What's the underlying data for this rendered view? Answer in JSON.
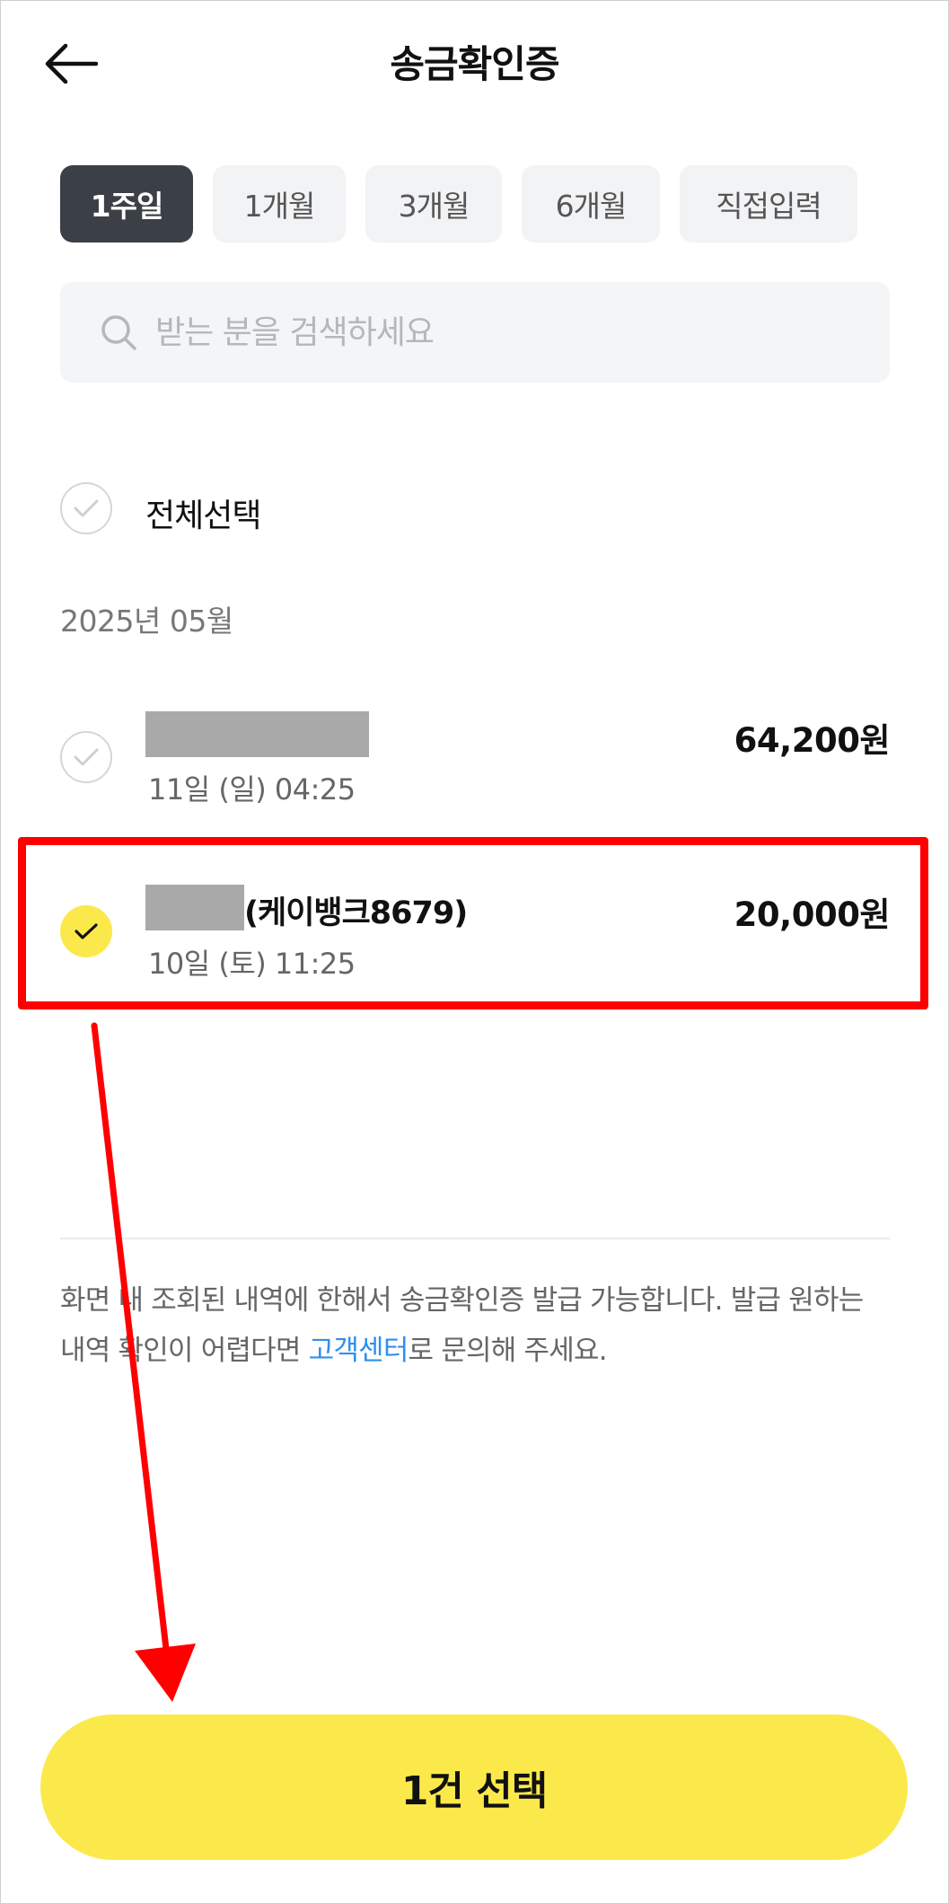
{
  "header": {
    "title": "송금확인증",
    "back_icon": "arrow-left-icon"
  },
  "period_filters": [
    {
      "label": "1주일",
      "selected": true
    },
    {
      "label": "1개월",
      "selected": false
    },
    {
      "label": "3개월",
      "selected": false
    },
    {
      "label": "6개월",
      "selected": false
    },
    {
      "label": "직접입력",
      "selected": false
    }
  ],
  "search": {
    "placeholder": "받는 분을 검색하세요",
    "value": "",
    "icon": "search-icon"
  },
  "select_all": {
    "label": "전체선택",
    "checked": false
  },
  "month_header": "2025년 05월",
  "transactions": [
    {
      "name": "",
      "name_redacted": true,
      "date": "11일 (일) 04:25",
      "amount": "64,200원",
      "checked": false
    },
    {
      "name": "(케이뱅크8679)",
      "name_redacted": true,
      "date": "10일 (토) 11:25",
      "amount": "20,000원",
      "checked": true
    }
  ],
  "notice": {
    "text_before": "화면 내 조회된 내역에 한해서 송금확인증 발급 가능합니다. 발급 원하는 내역 확인이 어렵다면 ",
    "link": "고객센터",
    "text_after": "로 문의해 주세요."
  },
  "cta": {
    "label": "1건 선택"
  },
  "colors": {
    "accent_yellow": "#fbe94c",
    "chip_active": "#3b4047",
    "link_blue": "#2f8ff0",
    "annotation_red": "#ff0000"
  }
}
